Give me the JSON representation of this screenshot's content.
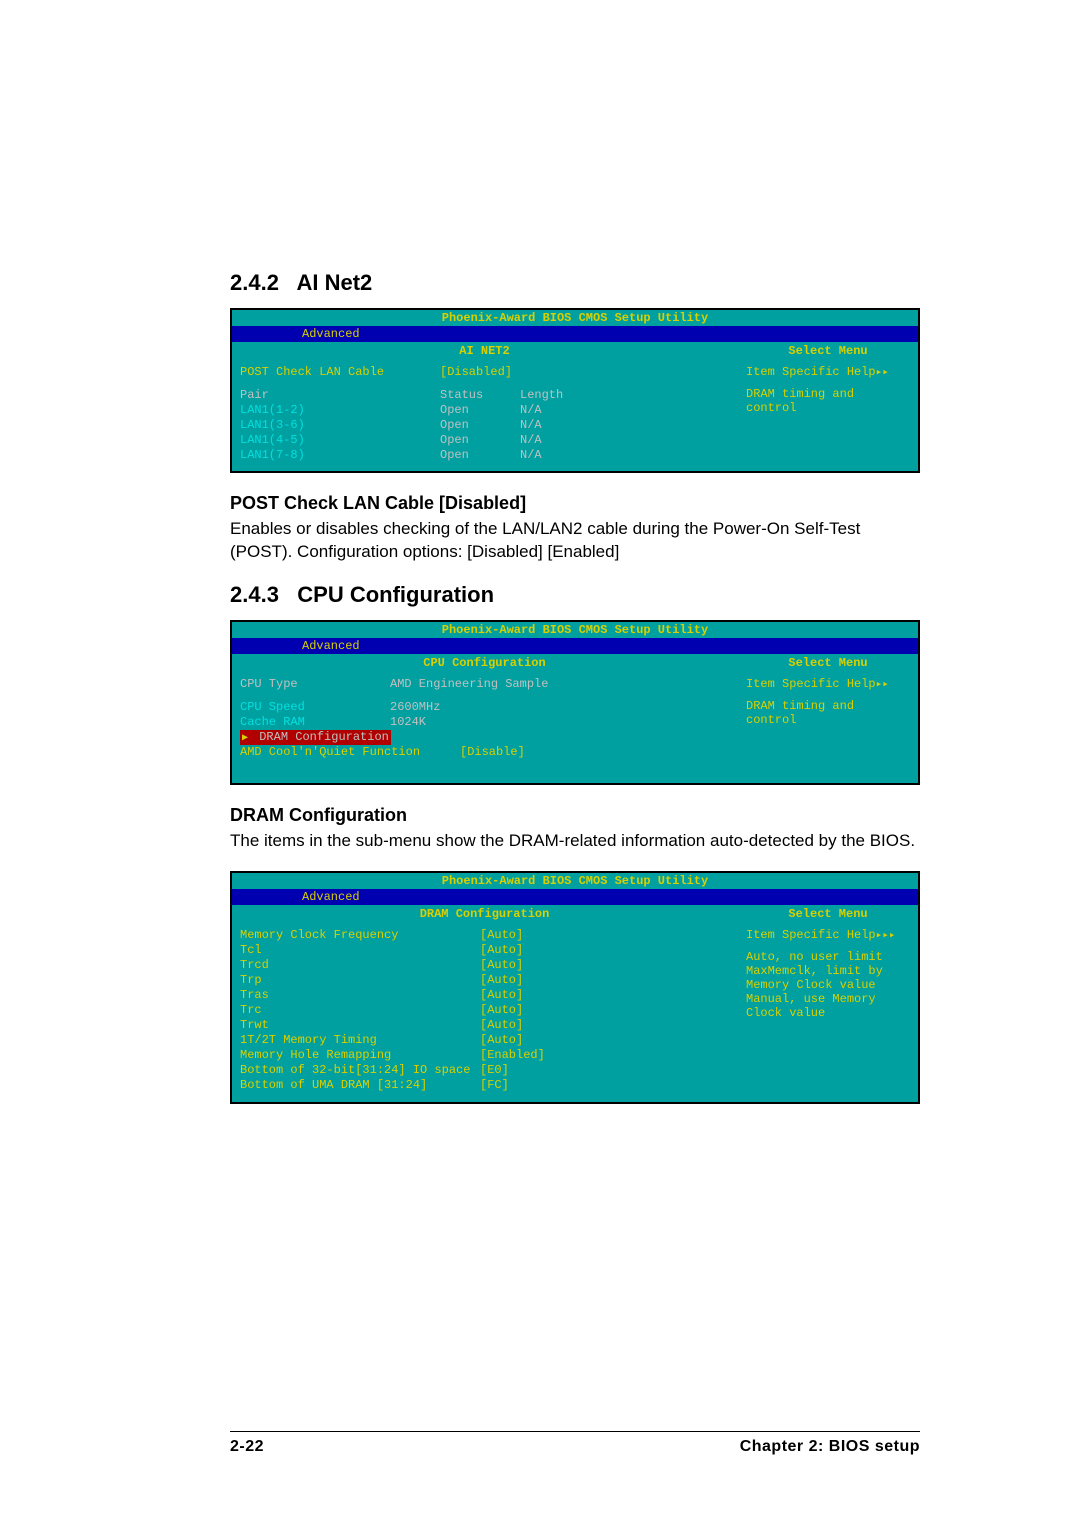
{
  "sections": {
    "s1": {
      "num": "2.4.2",
      "title": "AI Net2"
    },
    "s2": {
      "num": "2.4.3",
      "title": "CPU Configuration"
    }
  },
  "bios_common": {
    "utility_title": "Phoenix-Award BIOS CMOS Setup Utility",
    "tab": "Advanced",
    "select_menu": "Select Menu",
    "item_help": "Item Specific Help",
    "dram_msg": "DRAM timing and control"
  },
  "bios1": {
    "panel_title": "AI NET2",
    "post_label": "POST Check LAN Cable",
    "post_value": "[Disabled]",
    "head": {
      "pair": "Pair",
      "status": "Status",
      "length": "Length"
    },
    "rows": [
      {
        "pair": "LAN1(1-2)",
        "status": "Open",
        "length": "N/A"
      },
      {
        "pair": "LAN1(3-6)",
        "status": "Open",
        "length": "N/A"
      },
      {
        "pair": "LAN1(4-5)",
        "status": "Open",
        "length": "N/A"
      },
      {
        "pair": "LAN1(7-8)",
        "status": "Open",
        "length": "N/A"
      }
    ]
  },
  "post_heading": "POST Check LAN Cable [Disabled]",
  "post_para1": "Enables or disables checking of the LAN/LAN2 cable during the Power-On Self-Test (POST). Configuration options: [Disabled] [Enabled]",
  "bios2": {
    "panel_title": "CPU Configuration",
    "cpu_type_label": "CPU Type",
    "cpu_type_value": "AMD Engineering Sample",
    "cpu_speed_label": "CPU Speed",
    "cpu_speed_value": "2600MHz",
    "cache_label": "Cache RAM",
    "cache_value": "1024K",
    "dram_cfg": "DRAM Configuration",
    "coolnquiet_label": "AMD Cool'n'Quiet Function",
    "coolnquiet_value": "[Disable]"
  },
  "dram_heading": "DRAM Configuration",
  "dram_para": "The items in the sub-menu show the DRAM-related information auto-detected by the BIOS.",
  "bios3": {
    "panel_title": "DRAM Configuration",
    "items": [
      {
        "label": "Memory Clock Frequency",
        "value": "[Auto]"
      },
      {
        "label": "Tcl",
        "value": "[Auto]"
      },
      {
        "label": "Trcd",
        "value": "[Auto]"
      },
      {
        "label": "Trp",
        "value": "[Auto]"
      },
      {
        "label": "Tras",
        "value": "[Auto]"
      },
      {
        "label": "Trc",
        "value": "[Auto]"
      },
      {
        "label": "Trwt",
        "value": "[Auto]"
      },
      {
        "label": "1T/2T Memory Timing",
        "value": "[Auto]"
      },
      {
        "label": "Memory Hole Remapping",
        "value": "[Enabled]"
      },
      {
        "label": "Bottom of 32-bit[31:24] IO space",
        "value": "[E0]"
      },
      {
        "label": "Bottom of UMA DRAM [31:24]",
        "value": "[FC]"
      }
    ],
    "help_lines": [
      "Auto, no user limit",
      "MaxMemclk, limit by",
      "Memory Clock value",
      "Manual, use Memory",
      "Clock value"
    ]
  },
  "footer": {
    "page": "2-22",
    "chapter": "Chapter 2: BIOS setup"
  }
}
